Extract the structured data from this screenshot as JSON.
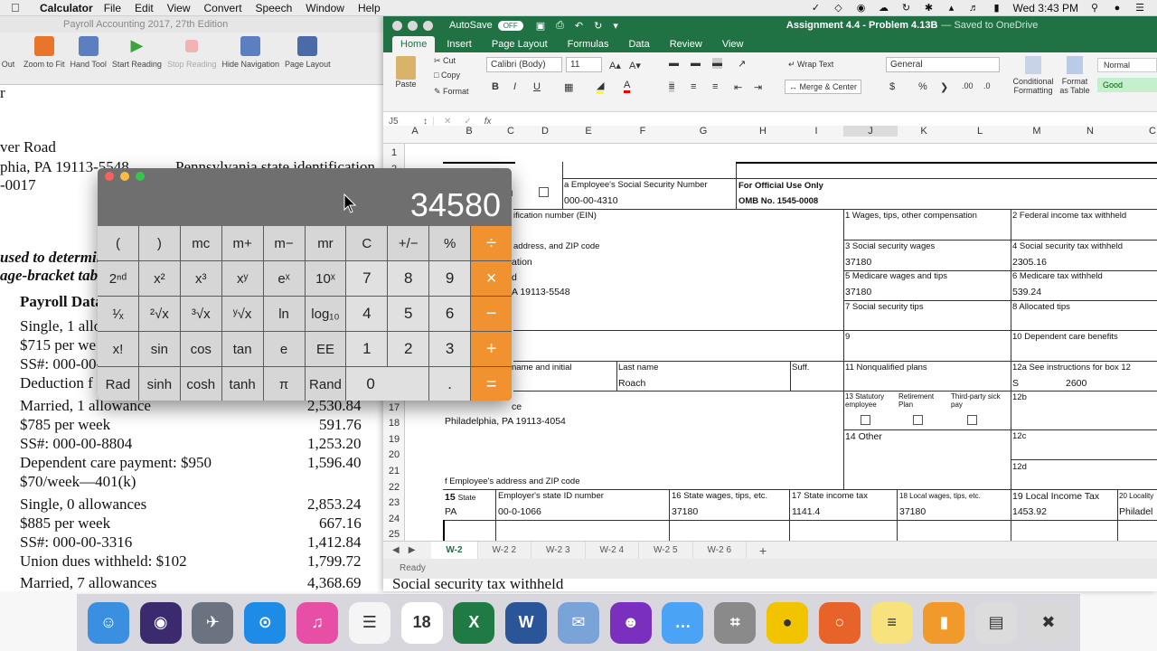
{
  "menubar": {
    "app_name": "Calculator",
    "menus": [
      "File",
      "Edit",
      "View",
      "Convert",
      "Speech",
      "Window",
      "Help"
    ],
    "clock": "Wed 3:43 PM"
  },
  "pdf": {
    "title": "Payroll Accounting 2017, 27th Edition",
    "toolbar": [
      "Out",
      "Zoom to Fit",
      "Hand Tool",
      "Start Reading",
      "Stop Reading",
      "Hide Navigation",
      "Page Layout"
    ],
    "lines": {
      "l1": "ver Road",
      "l2a": "phia, PA 19113-5548",
      "l2b": "Pennsylvania state identification",
      "l3": "-0017",
      "l4": "used to determin",
      "l5": "age-bracket tab",
      "l6": "Payroll Data",
      "r1": "Single, 1 allo",
      "r2": "$715 per we",
      "r3": "SS#: 000-00-",
      "r4": "Deduction f",
      "m1a": "Married, 1 allowance",
      "m1b": "2,530.84",
      "m2a": "$785 per week",
      "m2b": "591.76",
      "m3a": "SS#: 000-00-8804",
      "m3b": "1,253.20",
      "m4a": "Dependent care payment: $950",
      "m4b": "1,596.40",
      "m5a": "$70/week—401(k)",
      "s1a": "Single, 0 allowances",
      "s1b": "2,853.24",
      "s2a": "$885 per week",
      "s2b": "667.16",
      "s3a": "SS#: 000-00-3316",
      "s3b": "1,412.84",
      "s4a": "Union dues withheld: $102",
      "s4b": "1,799.72",
      "t1a": "Married, 7 allowances",
      "t1b": "4,368.69",
      "t1c": "Social security tax withheld"
    }
  },
  "excel": {
    "autosave": "AutoSave",
    "toggle": "OFF",
    "doc_title": "Assignment 4.4 - Problem 4.13B",
    "saved": "— Saved to OneDrive",
    "tabs": [
      "Home",
      "Insert",
      "Page Layout",
      "Formulas",
      "Data",
      "Review",
      "View"
    ],
    "ribbon": {
      "paste": "Paste",
      "cut": "Cut",
      "copy": "Copy",
      "format": "Format",
      "font": "Calibri (Body)",
      "size": "11",
      "wrap": "Wrap Text",
      "merge": "Merge & Center",
      "number_format": "General",
      "cond": "Conditional Formatting",
      "fmt_table": "Format as Table",
      "style_normal": "Normal",
      "style_good": "Good"
    },
    "name_box": "J5",
    "fx": "fx",
    "columns": [
      "A",
      "B",
      "C",
      "D",
      "E",
      "F",
      "G",
      "H",
      "I",
      "J",
      "K",
      "L",
      "M",
      "N",
      "C"
    ],
    "rows": [
      "1",
      "2",
      "3",
      "4",
      "5",
      "6",
      "7",
      "8",
      "9",
      "10",
      "11",
      "12",
      "13",
      "14",
      "15",
      "16",
      "17",
      "18",
      "19",
      "20",
      "21",
      "22",
      "23",
      "24",
      "25"
    ],
    "w2": {
      "d_label": "d",
      "a_label": "a Employee's Social Security Number",
      "a_val": "000-00-4310",
      "official1": "For Official Use Only",
      "official2": "OMB No. 1545-0008",
      "ein": "ification number (EIN)",
      "address": "address, and ZIP code",
      "ation": "ation",
      "d2": "d",
      "city": "A 19113-5548",
      "b1": "1  Wages, tips, other compensation",
      "b2": "2 Federal income tax withheld",
      "b3": "3 Social security wages",
      "b3v": "37180",
      "b4": "4 Social security tax withheld",
      "b4v": "2305.16",
      "b5": "5 Medicare wages and tips",
      "b5v": "37180",
      "b6": "6 Medicare tax withheld",
      "b6v": "539.24",
      "b7": "7 Social security tips",
      "b8": "8 Allocated tips",
      "b9": "9",
      "b10": "10 Dependent care benefits",
      "name_initial": "name and initial",
      "last_name": "Last name",
      "last_val": "Roach",
      "suff": "Suff.",
      "b11": "11 Nonqualified plans",
      "b12a": "12a See instructions for box 12",
      "b12a_code": "S",
      "b12a_val": "2600",
      "b13a": "13 Statutory employee",
      "b13b": "Retirement Plan",
      "b13c": "Third-party sick pay",
      "b12b": "12b",
      "ce": "ce",
      "emp_city": "Philadelphia, PA 19113-4054",
      "b14": "14 Other",
      "b12c": "12c",
      "b12d": "12d",
      "f_label": "f Employee's address and ZIP code",
      "b15": "15",
      "b15s": "State",
      "state_id": "Employer's state ID number",
      "b16": "16 State wages, tips, etc.",
      "b17": "17 State income tax",
      "b18": "18 Local wages, tips, etc.",
      "b19": "19 Local Income Tax",
      "b20": "20 Locality",
      "state_val": "PA",
      "state_id_val": "00-0-1066",
      "b16v": "37180",
      "b17v": "1141.4",
      "b18v": "37180",
      "b19v": "1453.92",
      "loc_val": "Philadel"
    },
    "sheets": [
      "W-2",
      "W-2 2",
      "W-2 3",
      "W-2 4",
      "W-2 5",
      "W-2 6"
    ],
    "status": "Ready"
  },
  "calculator": {
    "display": "34580",
    "keys": [
      {
        "label": "(",
        "t": "fn"
      },
      {
        "label": ")",
        "t": "fn"
      },
      {
        "label": "mc",
        "t": "fn"
      },
      {
        "label": "m+",
        "t": "fn"
      },
      {
        "label": "m−",
        "t": "fn"
      },
      {
        "label": "mr",
        "t": "fn"
      },
      {
        "label": "C",
        "t": "fn"
      },
      {
        "label": "+/−",
        "t": "fn"
      },
      {
        "label": "%",
        "t": "fn"
      },
      {
        "label": "÷",
        "t": "op"
      },
      {
        "label": "2ⁿᵈ",
        "t": "fn"
      },
      {
        "label": "x²",
        "t": "fn"
      },
      {
        "label": "x³",
        "t": "fn"
      },
      {
        "label": "xʸ",
        "t": "fn"
      },
      {
        "label": "eˣ",
        "t": "fn"
      },
      {
        "label": "10ˣ",
        "t": "fn"
      },
      {
        "label": "7",
        "t": "num"
      },
      {
        "label": "8",
        "t": "num"
      },
      {
        "label": "9",
        "t": "num"
      },
      {
        "label": "×",
        "t": "op"
      },
      {
        "label": "¹⁄ₓ",
        "t": "fn"
      },
      {
        "label": "²√x",
        "t": "fn"
      },
      {
        "label": "³√x",
        "t": "fn"
      },
      {
        "label": "ʸ√x",
        "t": "fn"
      },
      {
        "label": "ln",
        "t": "fn"
      },
      {
        "label": "log₁₀",
        "t": "fn"
      },
      {
        "label": "4",
        "t": "num"
      },
      {
        "label": "5",
        "t": "num"
      },
      {
        "label": "6",
        "t": "num"
      },
      {
        "label": "−",
        "t": "op"
      },
      {
        "label": "x!",
        "t": "fn"
      },
      {
        "label": "sin",
        "t": "fn"
      },
      {
        "label": "cos",
        "t": "fn"
      },
      {
        "label": "tan",
        "t": "fn"
      },
      {
        "label": "e",
        "t": "fn"
      },
      {
        "label": "EE",
        "t": "fn"
      },
      {
        "label": "1",
        "t": "num"
      },
      {
        "label": "2",
        "t": "num"
      },
      {
        "label": "3",
        "t": "num"
      },
      {
        "label": "+",
        "t": "op"
      },
      {
        "label": "Rad",
        "t": "fn"
      },
      {
        "label": "sinh",
        "t": "fn"
      },
      {
        "label": "cosh",
        "t": "fn"
      },
      {
        "label": "tanh",
        "t": "fn"
      },
      {
        "label": "π",
        "t": "fn"
      },
      {
        "label": "Rand",
        "t": "fn"
      },
      {
        "label": "0",
        "t": "zero"
      },
      {
        "label": ".",
        "t": "num"
      },
      {
        "label": "=",
        "t": "op"
      }
    ]
  },
  "dock": {
    "apps": [
      {
        "name": "finder-icon",
        "color": "#3a8fe0",
        "glyph": "☺"
      },
      {
        "name": "siri-icon",
        "color": "#3b2b6e",
        "glyph": "◉"
      },
      {
        "name": "launchpad-icon",
        "color": "#6b7380",
        "glyph": "✈"
      },
      {
        "name": "safari-icon",
        "color": "#1e8ce6",
        "glyph": "⊙"
      },
      {
        "name": "itunes-icon",
        "color": "#e74fa6",
        "glyph": "♫"
      },
      {
        "name": "reminders-icon",
        "color": "#f5f5f5",
        "glyph": "☰"
      },
      {
        "name": "calendar-icon",
        "color": "#ffffff",
        "glyph": "18"
      },
      {
        "name": "excel-icon",
        "color": "#1f7a44",
        "glyph": "X"
      },
      {
        "name": "word-icon",
        "color": "#2a5699",
        "glyph": "W"
      },
      {
        "name": "mail-icon",
        "color": "#7aa4d8",
        "glyph": "✉"
      },
      {
        "name": "yahoo-messenger-icon",
        "color": "#7b2fbf",
        "glyph": "☻"
      },
      {
        "name": "messages-icon",
        "color": "#4aa3f5",
        "glyph": "…"
      },
      {
        "name": "calculator-icon",
        "color": "#8a8a8a",
        "glyph": "⌗"
      },
      {
        "name": "security-icon",
        "color": "#f2c400",
        "glyph": "●"
      },
      {
        "name": "firefox-icon",
        "color": "#e8632a",
        "glyph": "○"
      },
      {
        "name": "notes-icon",
        "color": "#f7e27d",
        "glyph": "≡"
      },
      {
        "name": "ibooks-icon",
        "color": "#f19a2b",
        "glyph": "▮"
      },
      {
        "name": "downloads-icon",
        "color": "#dcdcdc",
        "glyph": "▤"
      },
      {
        "name": "trash-icon",
        "color": "#d8d8d8",
        "glyph": "✖"
      }
    ]
  }
}
